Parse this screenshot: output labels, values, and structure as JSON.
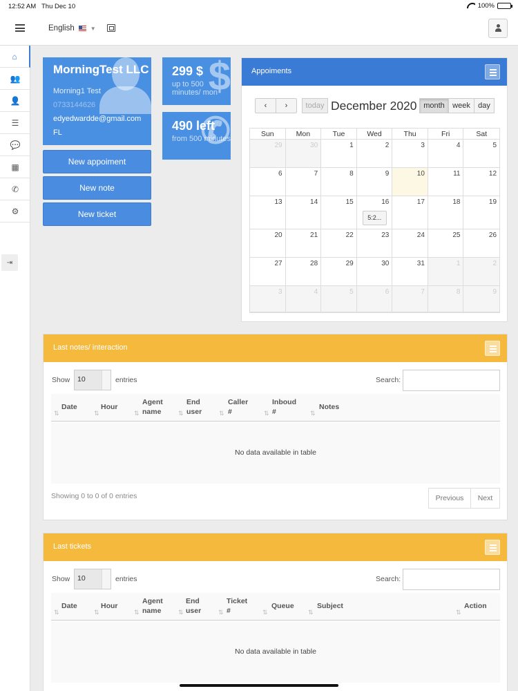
{
  "status_bar": {
    "time": "12:52 AM",
    "date": "Thu Dec 10",
    "battery": "100%"
  },
  "header": {
    "language": "English"
  },
  "sidebar": {
    "items": [
      {
        "icon": "home-icon",
        "glyph": "⌂"
      },
      {
        "icon": "users-icon",
        "glyph": "👥"
      },
      {
        "icon": "user-icon",
        "glyph": "👤"
      },
      {
        "icon": "list-icon",
        "glyph": "☰"
      },
      {
        "icon": "chat-icon",
        "glyph": "💬"
      },
      {
        "icon": "calendar-icon",
        "glyph": "▦"
      },
      {
        "icon": "phone-icon",
        "glyph": "✆"
      },
      {
        "icon": "settings-icon",
        "glyph": "⚙"
      }
    ]
  },
  "profile": {
    "company": "MorningTest LLC",
    "name": "Morning1 Test",
    "phone": "0733144626",
    "email": "edyedwardde@gmail.com",
    "state": "FL"
  },
  "actions": {
    "new_appointment": "New appoiment",
    "new_note": "New note",
    "new_ticket": "New ticket"
  },
  "stats": [
    {
      "value": "299 $",
      "caption": "up to 500 minutes/ mon",
      "icon": "$"
    },
    {
      "value": "490 left",
      "caption": "from 500 minutes",
      "icon": "✆"
    }
  ],
  "calendar": {
    "panel_title": "Appoiments",
    "title": "December 2020",
    "today_label": "today",
    "views": [
      "month",
      "week",
      "day"
    ],
    "active_view": "month",
    "dow": [
      "Sun",
      "Mon",
      "Tue",
      "Wed",
      "Thu",
      "Fri",
      "Sat"
    ],
    "weeks": [
      [
        {
          "d": "29",
          "o": true
        },
        {
          "d": "30",
          "o": true
        },
        {
          "d": "1"
        },
        {
          "d": "2"
        },
        {
          "d": "3"
        },
        {
          "d": "4"
        },
        {
          "d": "5"
        }
      ],
      [
        {
          "d": "6"
        },
        {
          "d": "7"
        },
        {
          "d": "8"
        },
        {
          "d": "9"
        },
        {
          "d": "10",
          "t": true
        },
        {
          "d": "11"
        },
        {
          "d": "12"
        }
      ],
      [
        {
          "d": "13"
        },
        {
          "d": "14"
        },
        {
          "d": "15"
        },
        {
          "d": "16",
          "e": "5:2..."
        },
        {
          "d": "17"
        },
        {
          "d": "18"
        },
        {
          "d": "19"
        }
      ],
      [
        {
          "d": "20"
        },
        {
          "d": "21"
        },
        {
          "d": "22"
        },
        {
          "d": "23"
        },
        {
          "d": "24"
        },
        {
          "d": "25"
        },
        {
          "d": "26"
        }
      ],
      [
        {
          "d": "27"
        },
        {
          "d": "28"
        },
        {
          "d": "29"
        },
        {
          "d": "30"
        },
        {
          "d": "31"
        },
        {
          "d": "1",
          "o": true
        },
        {
          "d": "2",
          "o": true
        }
      ],
      [
        {
          "d": "3",
          "o": true
        },
        {
          "d": "4",
          "o": true
        },
        {
          "d": "5",
          "o": true
        },
        {
          "d": "6",
          "o": true
        },
        {
          "d": "7",
          "o": true
        },
        {
          "d": "8",
          "o": true
        },
        {
          "d": "9",
          "o": true
        }
      ]
    ]
  },
  "notes_table": {
    "title": "Last notes/ interaction",
    "show_label": "Show",
    "length_value": "10",
    "entries_label": "entries",
    "search_label": "Search:",
    "columns": [
      "Date",
      "Hour",
      "Agent name",
      "End user",
      "Caller #",
      "Inboud #",
      "Notes"
    ],
    "empty_text": "No data available in table",
    "info": "Showing 0 to 0 of 0 entries",
    "prev": "Previous",
    "next": "Next"
  },
  "tickets_table": {
    "title": "Last tickets",
    "show_label": "Show",
    "length_value": "10",
    "entries_label": "entries",
    "search_label": "Search:",
    "columns": [
      "Date",
      "Hour",
      "Agent name",
      "End user",
      "Ticket #",
      "Queue",
      "Subject",
      "Action"
    ],
    "empty_text": "No data available in table"
  }
}
